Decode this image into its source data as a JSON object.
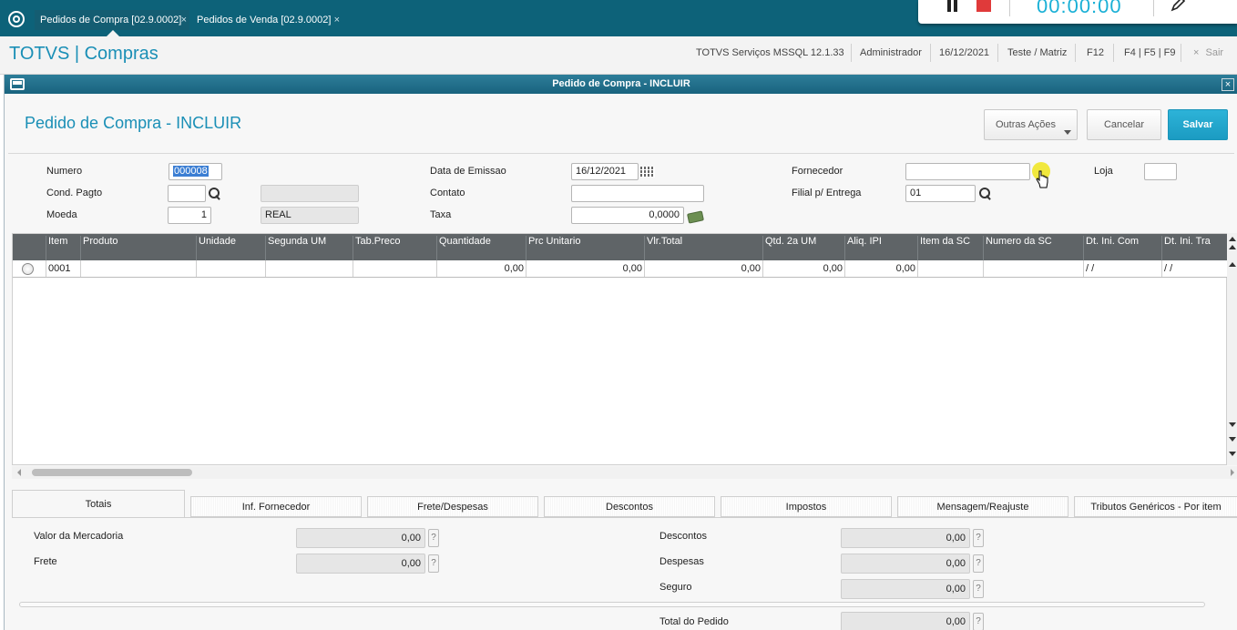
{
  "top_tabs": [
    {
      "label": "Pedidos de Compra [02.9.0002]",
      "close": "×"
    },
    {
      "label": "Pedidos de Venda [02.9.0002]",
      "close": "×"
    }
  ],
  "recorder": {
    "timer": "00:00:00"
  },
  "app": {
    "title": "TOTVS | Compras",
    "server": "TOTVS Serviços MSSQL 12.1.33",
    "user": "Administrador",
    "date": "16/12/2021",
    "company": "Teste / Matriz",
    "shortcut1": "F12",
    "shortcut2": "F4 | F5 | F9",
    "exit_icon": "×",
    "exit_label": "Sair"
  },
  "dialog": {
    "title": "Pedido de Compra - INCLUIR",
    "close": "×",
    "heading": "Pedido de Compra - INCLUIR",
    "buttons": {
      "other_actions": "Outras Ações",
      "cancel": "Cancelar",
      "save": "Salvar"
    }
  },
  "form": {
    "numero_label": "Numero",
    "numero_value": "000008",
    "cond_label": "Cond. Pagto",
    "cond_value": "",
    "cond_desc": "",
    "moeda_label": "Moeda",
    "moeda_value": "1",
    "moeda_desc": "REAL",
    "emissao_label": "Data de Emissao",
    "emissao_value": "16/12/2021",
    "contato_label": "Contato",
    "contato_value": "",
    "taxa_label": "Taxa",
    "taxa_value": "0,0000",
    "fornecedor_label": "Fornecedor",
    "fornecedor_value": "",
    "filial_label": "Filial p/ Entrega",
    "filial_value": "01",
    "loja_label": "Loja",
    "loja_value": ""
  },
  "grid": {
    "columns": [
      "Item",
      "Produto",
      "Unidade",
      "Segunda UM",
      "Tab.Preco",
      "Quantidade",
      "Prc Unitario",
      "Vlr.Total",
      "Qtd. 2a UM",
      "Aliq. IPI",
      "Item da SC",
      "Numero da SC",
      "Dt. Ini. Com",
      "Dt. Ini. Tra"
    ],
    "rows": [
      [
        "0001",
        "",
        "",
        "",
        "",
        "0,00",
        "0,00",
        "0,00",
        "0,00",
        "0,00",
        "",
        "",
        " / /",
        " / /"
      ]
    ]
  },
  "folder_tabs": [
    "Totais",
    "Inf. Fornecedor",
    "Frete/Despesas",
    "Descontos",
    "Impostos",
    "Mensagem/Reajuste",
    "Tributos Genéricos - Por item"
  ],
  "totals": {
    "mercadoria_label": "Valor da Mercadoria",
    "mercadoria_value": "0,00",
    "frete_label": "Frete",
    "frete_value": "0,00",
    "descontos_label": "Descontos",
    "descontos_value": "0,00",
    "despesas_label": "Despesas",
    "despesas_value": "0,00",
    "seguro_label": "Seguro",
    "seguro_value": "0,00",
    "total_label": "Total do Pedido",
    "total_value": "0,00",
    "help": "?"
  },
  "colors": {
    "brand": "#1a8fb6",
    "topbar": "#0d6279",
    "primary_button": "#1b9bc2",
    "grid_header": "#5f6467"
  }
}
